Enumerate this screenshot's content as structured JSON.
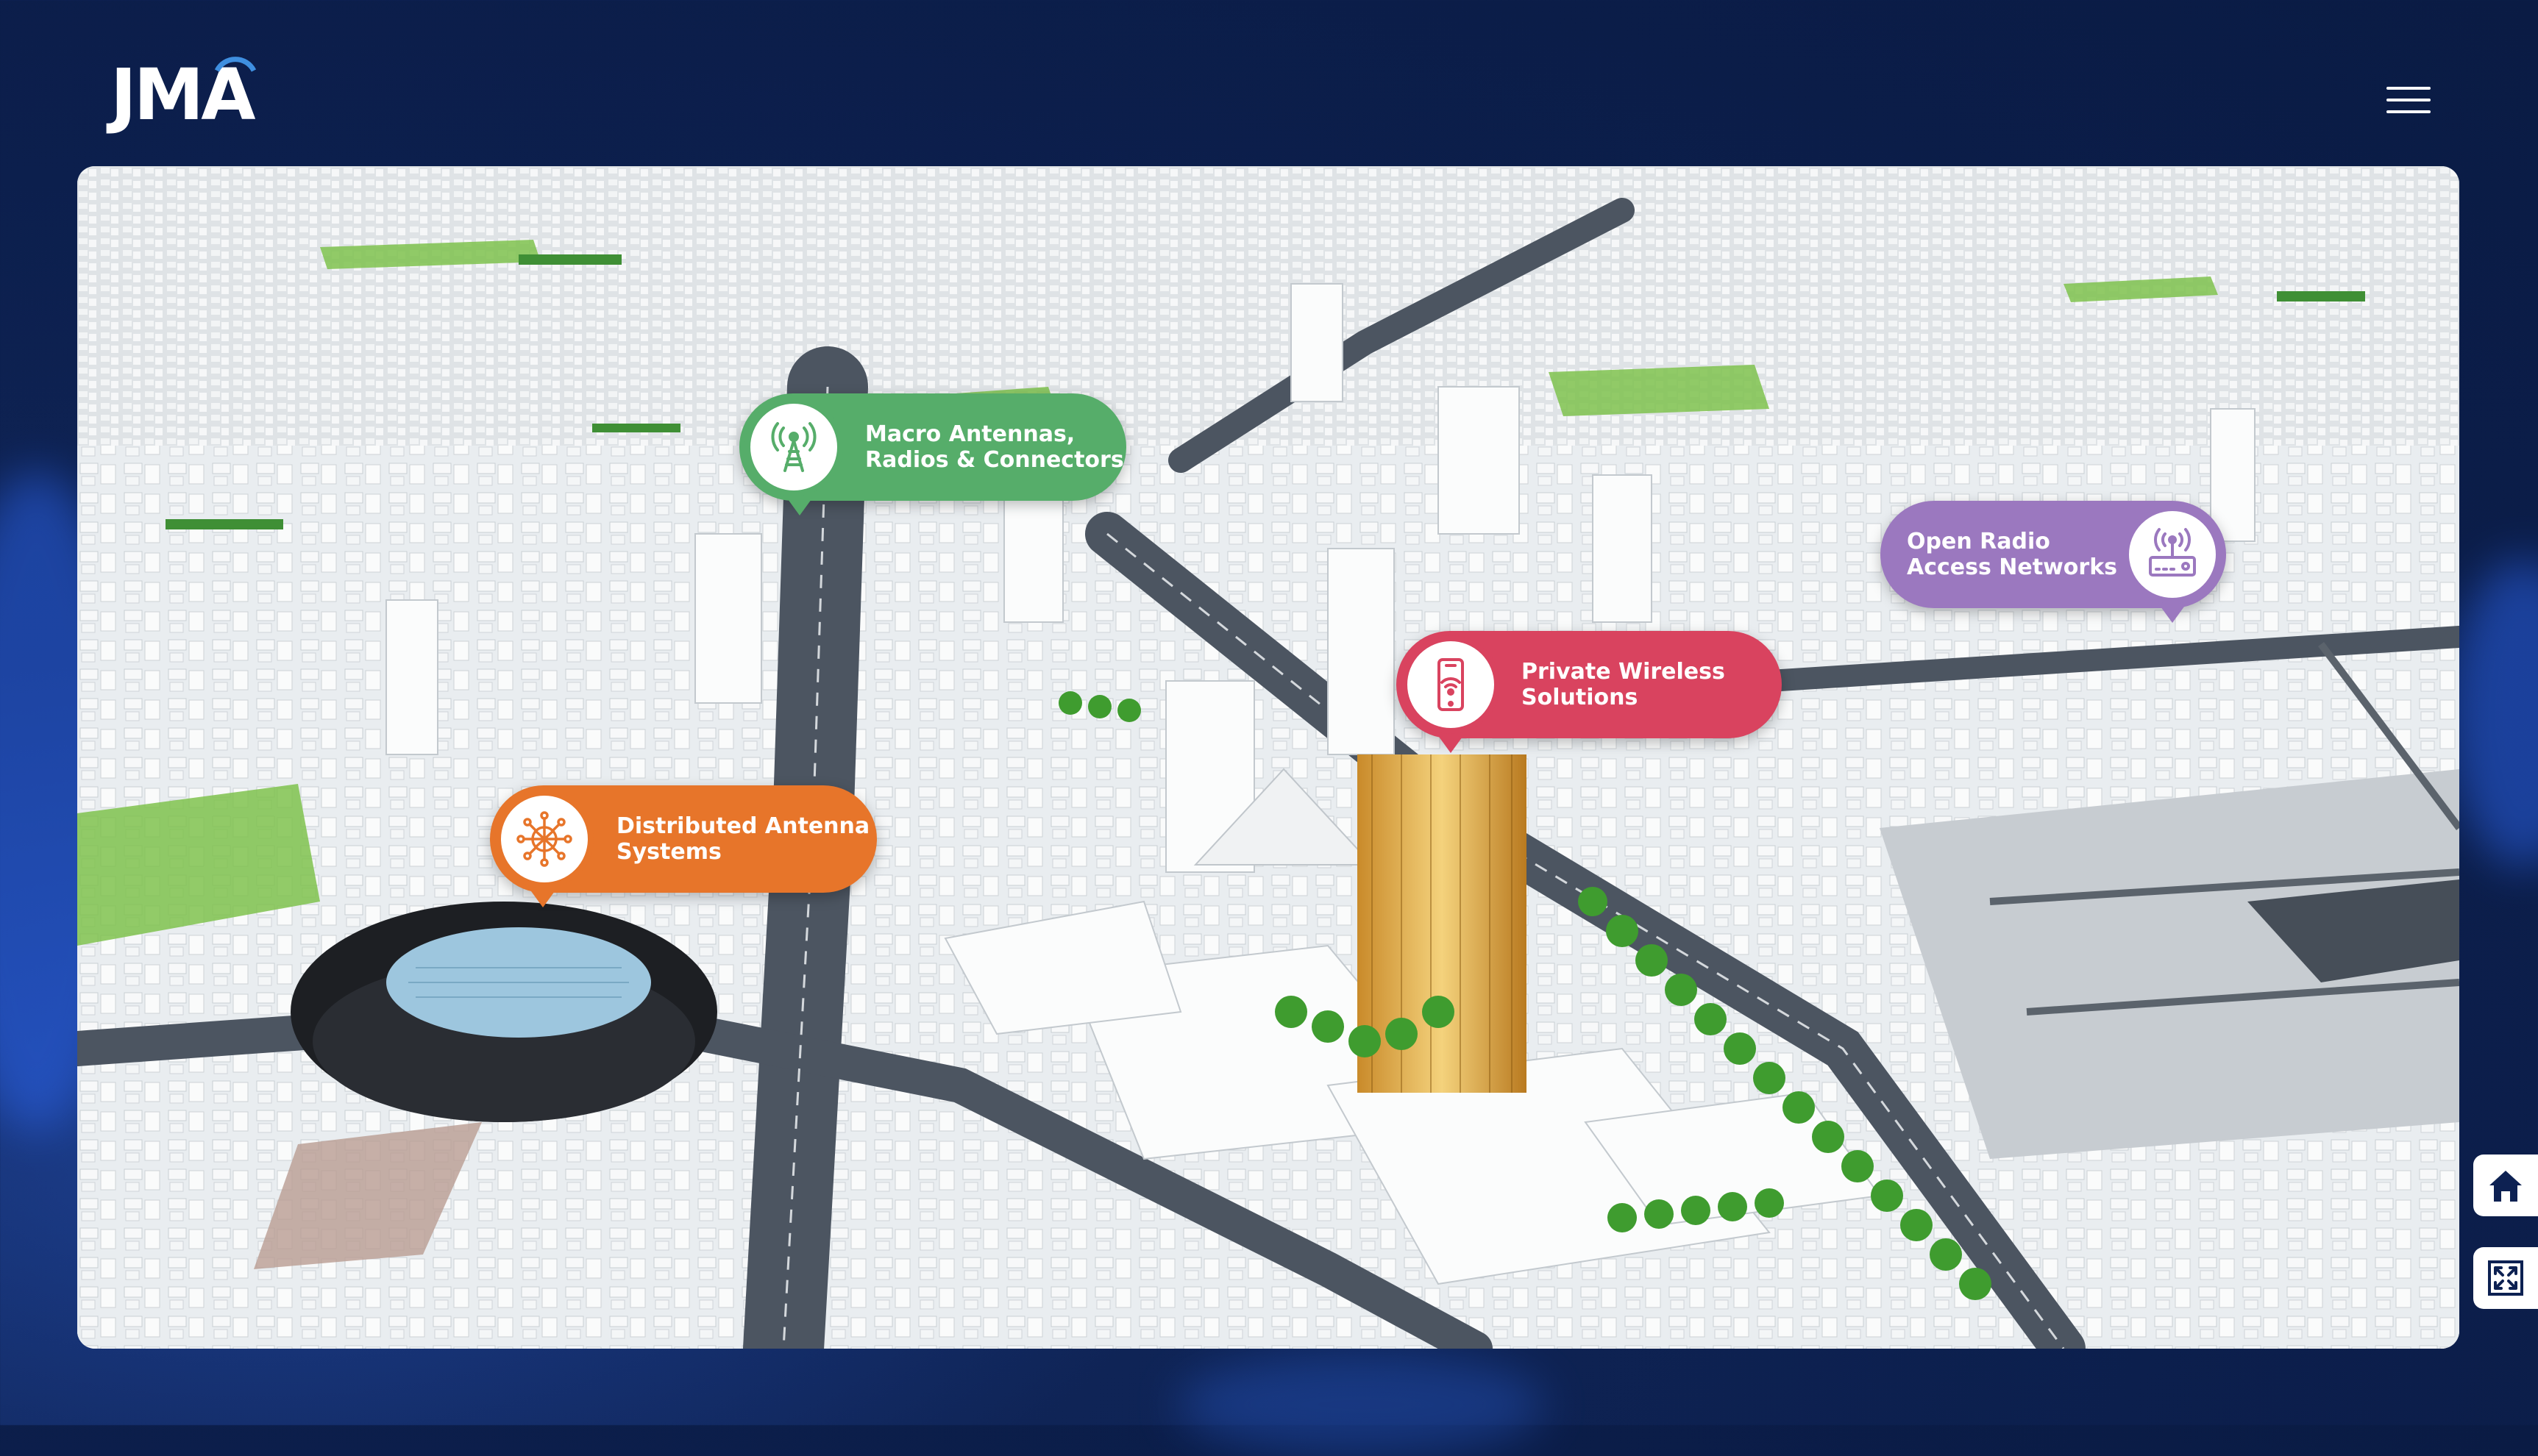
{
  "brand": {
    "logo_text": "JMA"
  },
  "header": {
    "menu_icon": "hamburger-menu-icon"
  },
  "map": {
    "scene": "city aerial view"
  },
  "pins": [
    {
      "id": "macro",
      "label_line1": "Macro Antennas,",
      "label_line2": "Radios & Connectors",
      "icon": "cell-tower-icon",
      "color": "#56ad6a"
    },
    {
      "id": "oran",
      "label_line1": "Open Radio",
      "label_line2": "Access Networks",
      "icon": "radio-router-icon",
      "color": "#9b78bf"
    },
    {
      "id": "private",
      "label_line1": "Private Wireless",
      "label_line2": "Solutions",
      "icon": "mobile-wifi-icon",
      "color": "#d9435f"
    },
    {
      "id": "das",
      "label_line1": "Distributed Antenna",
      "label_line2": "Systems",
      "icon": "antenna-network-icon",
      "color": "#e7752a"
    }
  ],
  "side_controls": [
    {
      "id": "home",
      "icon": "home-icon"
    },
    {
      "id": "fullscreen",
      "icon": "fullscreen-icon"
    }
  ]
}
